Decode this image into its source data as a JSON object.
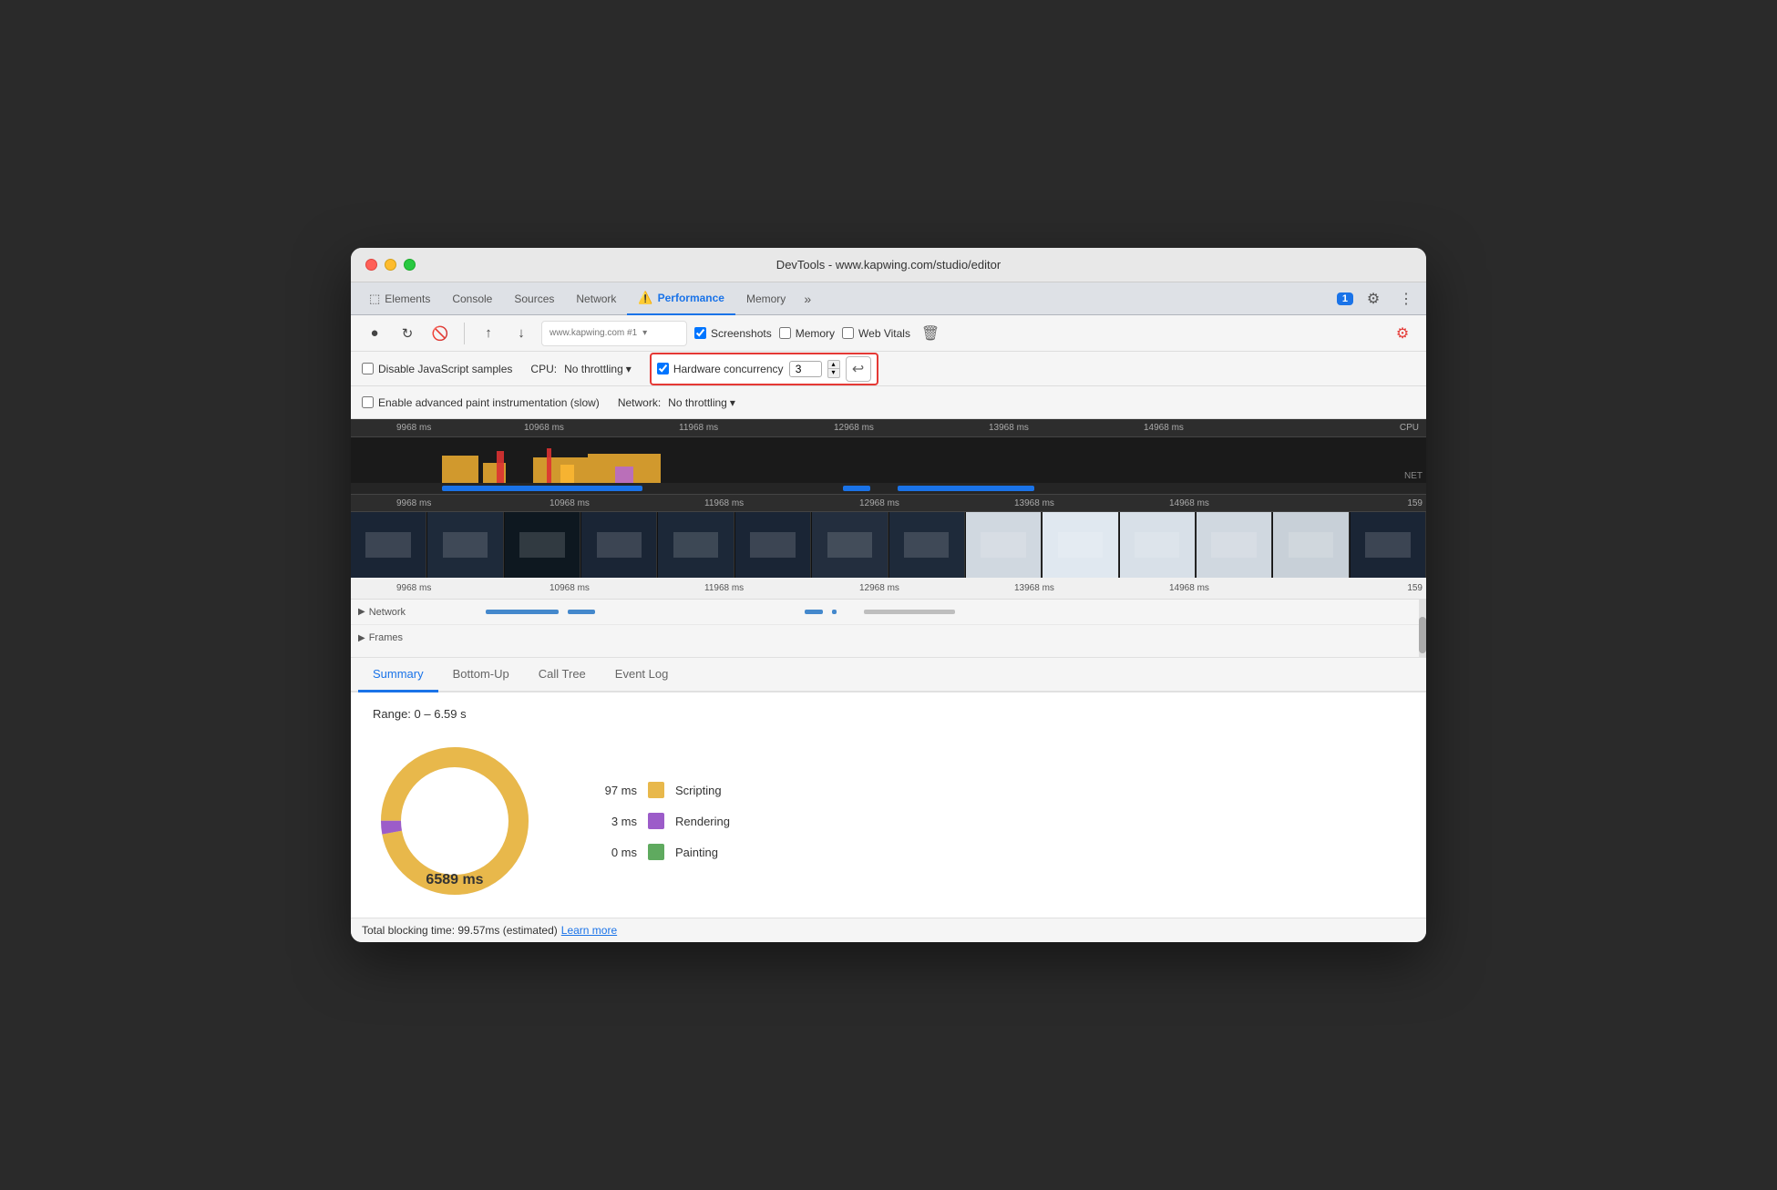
{
  "window": {
    "title": "DevTools - www.kapwing.com/studio/editor"
  },
  "tabs": {
    "items": [
      {
        "label": "Elements",
        "active": false
      },
      {
        "label": "Console",
        "active": false
      },
      {
        "label": "Sources",
        "active": false
      },
      {
        "label": "Network",
        "active": false
      },
      {
        "label": "Performance",
        "active": true,
        "icon": "⚠️"
      },
      {
        "label": "Memory",
        "active": false
      }
    ],
    "more_label": "»",
    "badge_count": "1"
  },
  "toolbar": {
    "record_label": "●",
    "refresh_label": "↻",
    "clear_label": "🚫",
    "upload_label": "↑",
    "download_label": "↓",
    "url_text": "www.kapwing.com #1",
    "screenshots_label": "Screenshots",
    "memory_label": "Memory",
    "web_vitals_label": "Web Vitals",
    "delete_label": "🗑"
  },
  "settings": {
    "disable_js_label": "Disable JavaScript samples",
    "enable_paint_label": "Enable advanced paint instrumentation (slow)",
    "cpu_label": "CPU:",
    "cpu_throttle": "No throttling",
    "network_label": "Network:",
    "network_throttle": "No throttling",
    "hw_concurrency_label": "Hardware concurrency",
    "hw_value": "3",
    "undo_label": "↩"
  },
  "timeline": {
    "ticks": [
      "9968 ms",
      "10968 ms",
      "11968 ms",
      "12968 ms",
      "13968 ms",
      "14968 ms"
    ],
    "bottom_ticks": [
      "9968 ms",
      "10968 ms",
      "11968 ms",
      "12968 ms",
      "13968 ms",
      "14968 ms",
      "159"
    ],
    "cpu_label": "CPU",
    "net_label": "NET"
  },
  "side_panel": {
    "network_label": "Network",
    "frames_label": "Frames",
    "triangle": "▶"
  },
  "panel_tabs": {
    "items": [
      {
        "label": "Summary",
        "active": true
      },
      {
        "label": "Bottom-Up",
        "active": false
      },
      {
        "label": "Call Tree",
        "active": false
      },
      {
        "label": "Event Log",
        "active": false
      }
    ]
  },
  "summary": {
    "range_text": "Range: 0 – 6.59 s",
    "center_value": "6589 ms",
    "legend": [
      {
        "value": "97 ms",
        "color": "#e8b84b",
        "label": "Scripting"
      },
      {
        "value": "3 ms",
        "color": "#9c5cc9",
        "label": "Rendering"
      },
      {
        "value": "0 ms",
        "color": "#5faa5f",
        "label": "Painting"
      }
    ]
  },
  "status_bar": {
    "text": "Total blocking time: 99.57ms (estimated)",
    "link_text": "Learn more"
  },
  "colors": {
    "accent_blue": "#1a73e8",
    "accent_red": "#e53935",
    "active_tab": "#1a73e8"
  }
}
